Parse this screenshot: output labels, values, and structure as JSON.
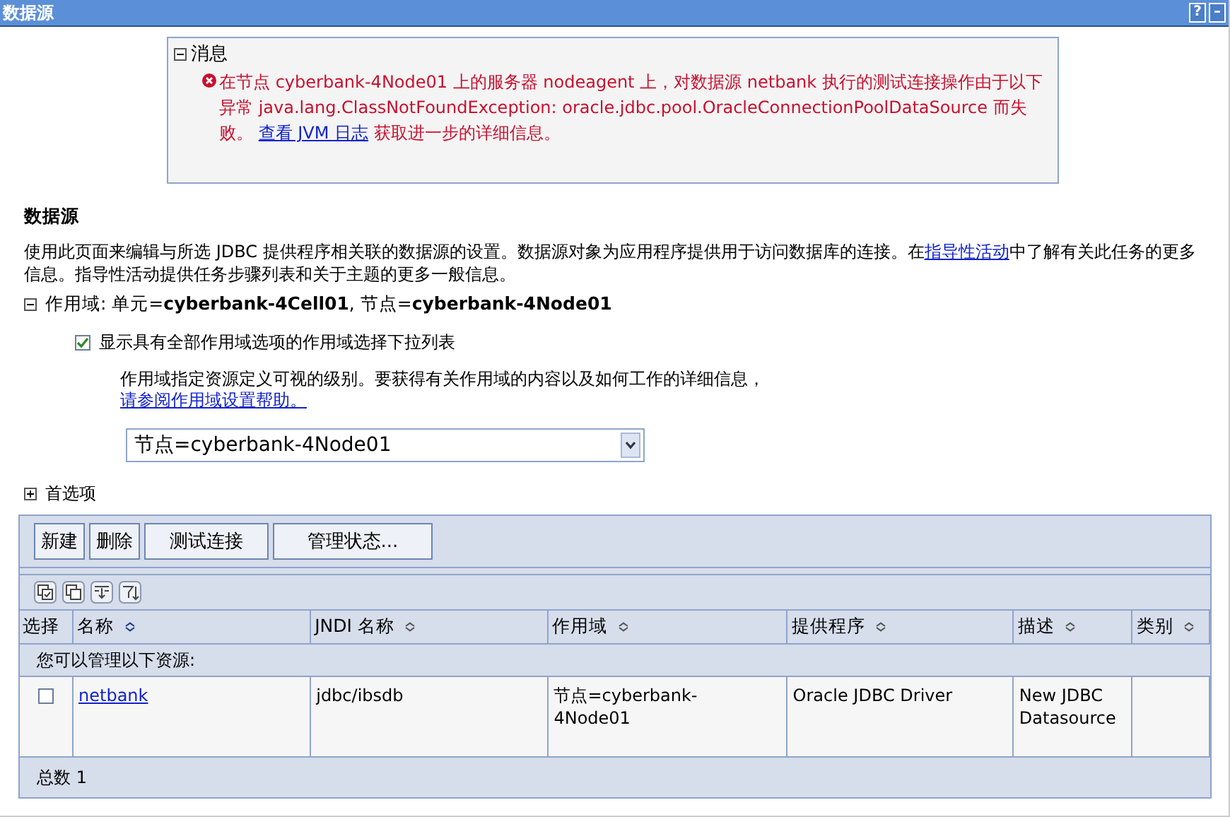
{
  "window": {
    "title": "数据源",
    "controls": [
      "?",
      "–"
    ]
  },
  "message": {
    "title": "消息",
    "expanded": true,
    "text": "在节点 cyberbank-4Node01 上的服务器 nodeagent 上，对数据源 netbank 执行的测试连接操作由于以下异常 java.lang.ClassNotFoundException: oracle.jdbc.pool.OracleConnectionPoolDataSource 而失败。",
    "link": "查看 JVM 日志",
    "after": "获取进一步的详细信息。"
  },
  "section": {
    "heading": "数据源",
    "description": "使用此页面来编辑与所选 JDBC 提供程序相关联的数据源的设置。数据源对象为应用程序提供用于访问数据库的连接。在",
    "description_link": "指导性活动",
    "description_after": "中了解有关此任务的更多信息。指导性活动提供任务步骤列表和关于主题的更多一般信息。"
  },
  "scope": {
    "label": "作用域: 单元=",
    "cell": "cyberbank-4Cell01",
    "node_label": ", 节点=",
    "node": "cyberbank-4Node01",
    "expanded": true,
    "checkbox": {
      "label": "显示具有全部作用域选项的作用域选择下拉列表",
      "checked": true
    },
    "help": "作用域指定资源定义可视的级别。要获得有关作用域的内容以及如何工作的详细信息，",
    "help_link": "请参阅作用域设置帮助。",
    "select": {
      "value": "节点=cyberbank-4Node01"
    }
  },
  "preferences": {
    "label": "首选项",
    "expanded": false
  },
  "buttons": [
    "新建",
    "删除",
    "测试连接",
    "管理状态..."
  ],
  "table": {
    "columns": [
      {
        "label": "选择",
        "sortable": false
      },
      {
        "label": "名称",
        "sortable": true
      },
      {
        "label": "JNDI 名称",
        "sortable": true
      },
      {
        "label": "作用域",
        "sortable": true
      },
      {
        "label": "提供程序",
        "sortable": true
      },
      {
        "label": "描述",
        "sortable": true
      },
      {
        "label": "类别",
        "sortable": true
      }
    ],
    "group": "您可以管理以下资源:",
    "rows": [
      {
        "checked": false,
        "name": "netbank",
        "jndi": "jdbc/ibsdb",
        "scope": "节点=cyberbank-4Node01",
        "provider": "Oracle JDBC Driver",
        "description": "New JDBC Datasource"
      }
    ],
    "total": "总数  1"
  }
}
